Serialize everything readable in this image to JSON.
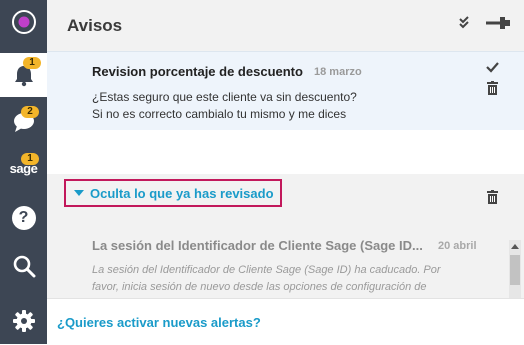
{
  "header": {
    "title": "Avisos"
  },
  "sidebar": {
    "notifications_badge": "1",
    "messages_badge": "2",
    "sage_badge": "1",
    "sage_label": "sage",
    "help_label": "?"
  },
  "notification": {
    "title": "Revision porcentaje de descuento",
    "date": "18 marzo",
    "body_line1": "¿Estas seguro que este cliente va sin descuento?",
    "body_line2": "Si no es correcto cambialo tu mismo y me dices"
  },
  "read_section": {
    "toggle_label": "Oculta lo que ya has revisado",
    "item": {
      "title": "La sesión del Identificador de Cliente Sage (Sage ID...",
      "date": "20 abril",
      "body_line1": "La sesión del Identificador de Cliente Sage (Sage ID) ha caducado. Por",
      "body_line2": "favor, inicia sesión de nuevo desde las opciones de configuración de"
    }
  },
  "footer": {
    "link": "¿Quieres activar nuevas alertas?"
  },
  "colors": {
    "rail": "#3d4654",
    "accent": "#1a9bc9",
    "badge": "#f3b52a",
    "highlight_border": "#c2185b"
  }
}
